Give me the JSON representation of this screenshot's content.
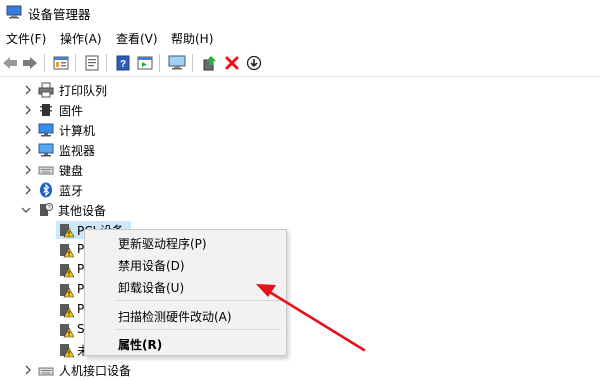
{
  "window": {
    "title": "设备管理器",
    "icon": "device-manager-icon"
  },
  "menu": [
    "文件(F)",
    "操作(A)",
    "查看(V)",
    "帮助(H)"
  ],
  "toolbar": [
    "back-arrow-icon",
    "forward-arrow-icon",
    "show-hide-tree-icon",
    "properties-sheet-icon",
    "help-icon",
    "action-pane-icon",
    "monitor-scan-icon",
    "update-driver-icon",
    "uninstall-x-icon",
    "download-circle-icon"
  ],
  "colors": {
    "accent_red": "#e8101a",
    "selection": "#cce8ff",
    "menu_bg": "#f2f2f2"
  },
  "tree": {
    "categories": [
      {
        "label": "打印队列",
        "icon": "printer-icon"
      },
      {
        "label": "固件",
        "icon": "firmware-icon"
      },
      {
        "label": "计算机",
        "icon": "computer-icon"
      },
      {
        "label": "监视器",
        "icon": "monitor-icon"
      },
      {
        "label": "键盘",
        "icon": "keyboard-icon"
      },
      {
        "label": "蓝牙",
        "icon": "bluetooth-icon"
      }
    ],
    "other_devices": {
      "label": "其他设备",
      "children": [
        "PCI 设备",
        "P",
        "P",
        "P",
        "P",
        "S",
        "未"
      ]
    },
    "last": {
      "label": "人机接口设备",
      "icon": "hid-icon"
    }
  },
  "context_menu": [
    {
      "label": "更新驱动程序(P)",
      "bold": false
    },
    {
      "label": "禁用设备(D)",
      "bold": false
    },
    {
      "label": "卸载设备(U)",
      "bold": false
    },
    {
      "label": "扫描检测硬件改动(A)",
      "bold": false
    },
    {
      "label": "属性(R)",
      "bold": true
    }
  ]
}
